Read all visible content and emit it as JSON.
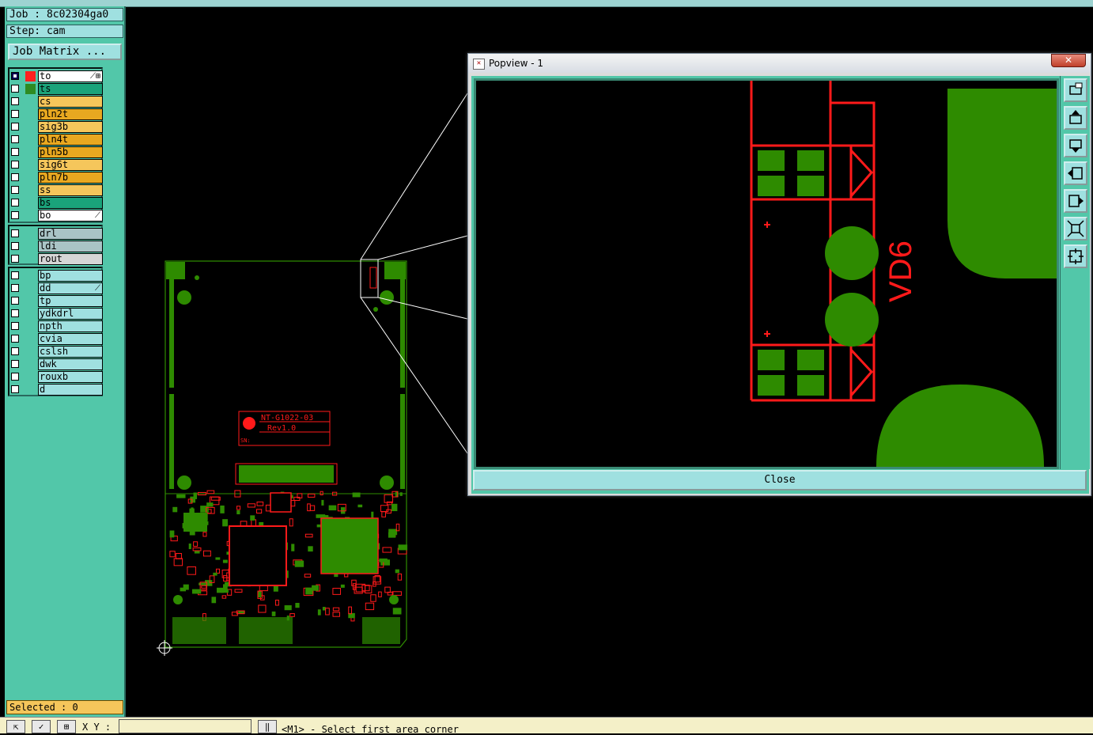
{
  "job_label": "Job : 8c02304ga0",
  "step_label": "Step: cam",
  "job_matrix_button": "Job Matrix ...",
  "layers_board": [
    {
      "name": "to",
      "bg": "#ffffff",
      "swatch": "#ff2020",
      "checked": true,
      "flag": "⟋⊞"
    },
    {
      "name": "ts",
      "bg": "#1aa37a",
      "swatch": "#2e8b22",
      "checked": false,
      "flag": ""
    },
    {
      "name": "cs",
      "bg": "#f5c65b",
      "swatch": "",
      "checked": false,
      "flag": ""
    },
    {
      "name": "pln2t",
      "bg": "#e8a820",
      "swatch": "",
      "checked": false,
      "flag": ""
    },
    {
      "name": "sig3b",
      "bg": "#f5c65b",
      "swatch": "",
      "checked": false,
      "flag": ""
    },
    {
      "name": "pln4t",
      "bg": "#e8a820",
      "swatch": "",
      "checked": false,
      "flag": ""
    },
    {
      "name": "pln5b",
      "bg": "#e8a820",
      "swatch": "",
      "checked": false,
      "flag": ""
    },
    {
      "name": "sig6t",
      "bg": "#f5c65b",
      "swatch": "",
      "checked": false,
      "flag": ""
    },
    {
      "name": "pln7b",
      "bg": "#e8a820",
      "swatch": "",
      "checked": false,
      "flag": ""
    },
    {
      "name": "ss",
      "bg": "#f5c65b",
      "swatch": "",
      "checked": false,
      "flag": ""
    },
    {
      "name": "bs",
      "bg": "#1aa37a",
      "swatch": "",
      "checked": false,
      "flag": ""
    },
    {
      "name": "bo",
      "bg": "#ffffff",
      "swatch": "",
      "checked": false,
      "flag": "⟋"
    }
  ],
  "layers_drill": [
    {
      "name": "drl",
      "bg": "#a9c4c6",
      "swatch": "",
      "checked": false,
      "flag": ""
    },
    {
      "name": "ldi",
      "bg": "#a9c4c6",
      "swatch": "",
      "checked": false,
      "flag": ""
    },
    {
      "name": "rout",
      "bg": "#d6d6d6",
      "swatch": "",
      "checked": false,
      "flag": ""
    }
  ],
  "layers_misc": [
    {
      "name": "bp",
      "bg": "#9fe0e0",
      "swatch": "",
      "checked": false,
      "flag": ""
    },
    {
      "name": "dd",
      "bg": "#9fe0e0",
      "swatch": "",
      "checked": false,
      "flag": "⟋"
    },
    {
      "name": "tp",
      "bg": "#9fe0e0",
      "swatch": "",
      "checked": false,
      "flag": ""
    },
    {
      "name": "ydkdrl",
      "bg": "#9fe0e0",
      "swatch": "",
      "checked": false,
      "flag": ""
    },
    {
      "name": "npth",
      "bg": "#9fe0e0",
      "swatch": "",
      "checked": false,
      "flag": ""
    },
    {
      "name": "cvia",
      "bg": "#9fe0e0",
      "swatch": "",
      "checked": false,
      "flag": ""
    },
    {
      "name": "cslsh",
      "bg": "#9fe0e0",
      "swatch": "",
      "checked": false,
      "flag": ""
    },
    {
      "name": "dwk",
      "bg": "#9fe0e0",
      "swatch": "",
      "checked": false,
      "flag": ""
    },
    {
      "name": "rouxb",
      "bg": "#9fe0e0",
      "swatch": "",
      "checked": false,
      "flag": ""
    },
    {
      "name": "d",
      "bg": "#9fe0e0",
      "swatch": "",
      "checked": false,
      "flag": ""
    }
  ],
  "selected_label": "Selected : 0",
  "xy_label": "X Y :",
  "xy_value": "",
  "status_message": "<M1> - Select first area corner",
  "board_text": {
    "part": "NT-G1022-03",
    "rev": "Rev1.0",
    "sn": "SN:"
  },
  "popup": {
    "title": "Popview - 1",
    "close_x": "✕",
    "close_label": "Close",
    "component_label": "VD6",
    "side_buttons": [
      "zoom-home-icon",
      "pan-up-icon",
      "pan-down-icon",
      "pan-left-icon",
      "pan-right-icon",
      "zoom-in-icon",
      "zoom-out-icon"
    ]
  },
  "colors": {
    "pad": "#2e8b00",
    "trace": "#ff1a1a",
    "panel": "#52c7a9",
    "field": "#9fe0e0",
    "selected": "#f5c65b"
  }
}
